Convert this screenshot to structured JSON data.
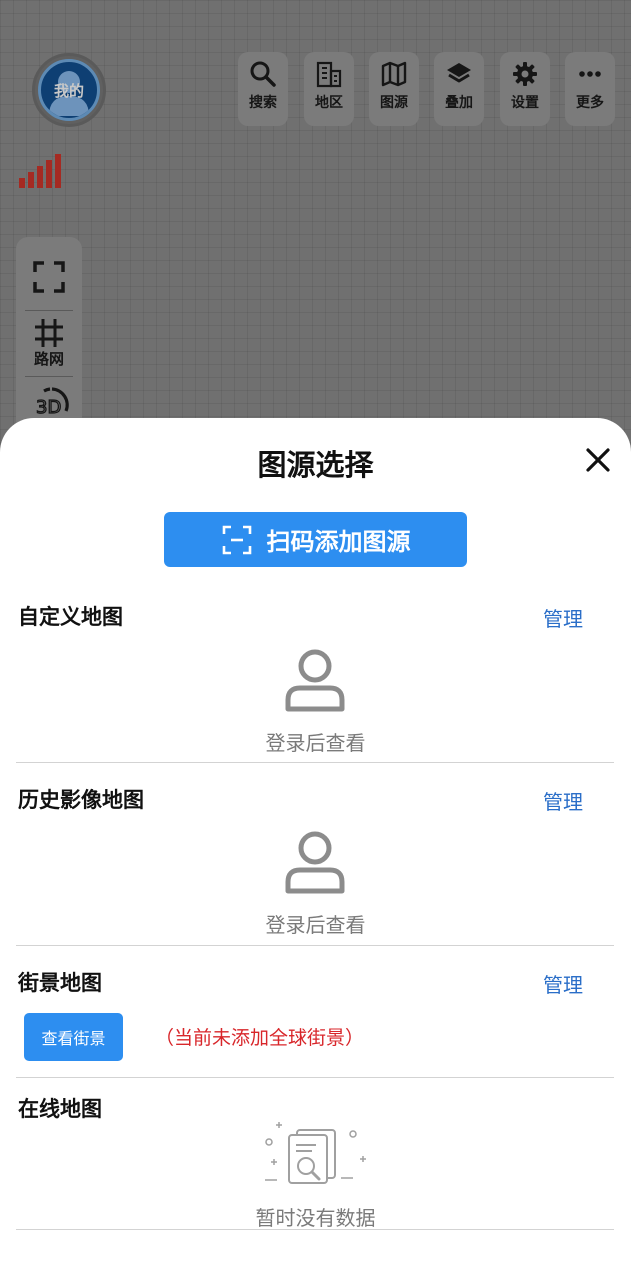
{
  "map": {
    "avatar_label": "我的",
    "toolbar": [
      {
        "label": "搜索",
        "icon": "search-icon"
      },
      {
        "label": "地区",
        "icon": "building-icon"
      },
      {
        "label": "图源",
        "icon": "map-icon"
      },
      {
        "label": "叠加",
        "icon": "layers-icon"
      },
      {
        "label": "设置",
        "icon": "gear-icon"
      },
      {
        "label": "更多",
        "icon": "more-icon"
      }
    ],
    "signal_color": "#a52a22",
    "side": {
      "fullscreen_icon": "fullscreen-icon",
      "road_label": "路网",
      "road_icon": "road-network-icon",
      "three_d_icon": "3d-icon"
    }
  },
  "sheet": {
    "title": "图源选择",
    "close_icon": "close-icon",
    "scan_button": "扫码添加图源",
    "scan_icon": "scan-icon",
    "sections": {
      "custom": {
        "title": "自定义地图",
        "manage": "管理",
        "empty": "登录后查看"
      },
      "history": {
        "title": "历史影像地图",
        "manage": "管理",
        "empty": "登录后查看"
      },
      "street": {
        "title": "街景地图",
        "manage": "管理",
        "button": "查看街景",
        "note": "（当前未添加全球街景）"
      },
      "online": {
        "title": "在线地图",
        "empty": "暂时没有数据"
      }
    }
  },
  "colors": {
    "accent": "#2d8ef0",
    "link": "#2a6ec8",
    "warning": "#d8262a"
  }
}
